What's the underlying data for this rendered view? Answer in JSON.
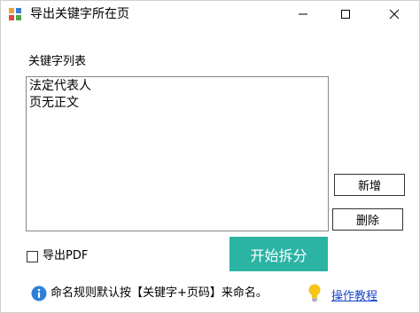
{
  "window": {
    "title": "导出关键字所在页",
    "app_icon": "app-grid-icon",
    "controls": [
      "minimize-icon",
      "maximize-icon",
      "close-icon"
    ]
  },
  "keywords": {
    "label": "关键字列表",
    "items": [
      "法定代表人",
      "页无正文"
    ]
  },
  "buttons": {
    "add": "新增",
    "delete": "删除",
    "start": "开始拆分"
  },
  "options": {
    "export_pdf_label": "导出PDF",
    "export_pdf_checked": false
  },
  "footer": {
    "info_icon": "info-icon",
    "info_text": "命名规则默认按【关键字+页码】来命名。",
    "bulb_icon": "lightbulb-icon",
    "tutorial_link": "操作教程"
  },
  "colors": {
    "start_button": "#2bb3a3",
    "link": "#1a47c9",
    "info_icon": "#2f7fd8",
    "bulb_icon": "#f5c518"
  }
}
